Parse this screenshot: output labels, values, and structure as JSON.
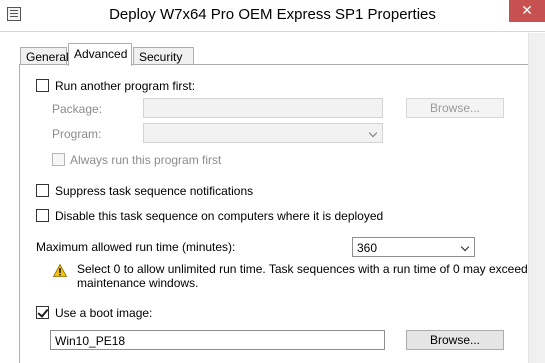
{
  "window": {
    "title": "Deploy W7x64 Pro OEM Express SP1 Properties",
    "close_glyph": "✕"
  },
  "tabs": [
    {
      "label": "General",
      "active": false
    },
    {
      "label": "Advanced",
      "active": true
    },
    {
      "label": "Security",
      "active": false
    }
  ],
  "advanced": {
    "run_another": {
      "label": "Run another program first:",
      "checked": false
    },
    "package": {
      "label": "Package:",
      "value": "",
      "browse_label": "Browse..."
    },
    "program": {
      "label": "Program:",
      "value": ""
    },
    "always_run": {
      "label": "Always run this program first",
      "checked": false
    },
    "suppress": {
      "label": "Suppress task sequence notifications",
      "checked": false
    },
    "disable": {
      "label": "Disable this task sequence on computers where it is deployed",
      "checked": false
    },
    "max_runtime": {
      "label": "Maximum allowed run time (minutes):",
      "value": "360"
    },
    "warning": {
      "text": "Select 0 to allow unlimited run time. Task sequences with a run time of 0 may exceed maintenance windows.",
      "icon": "warning-icon"
    },
    "boot_image": {
      "label": "Use a boot image:",
      "checked": true,
      "value": "Win10_PE18",
      "browse_label": "Browse..."
    }
  },
  "colors": {
    "close_button": "#c75050",
    "warning_fill": "#f4c20d"
  }
}
